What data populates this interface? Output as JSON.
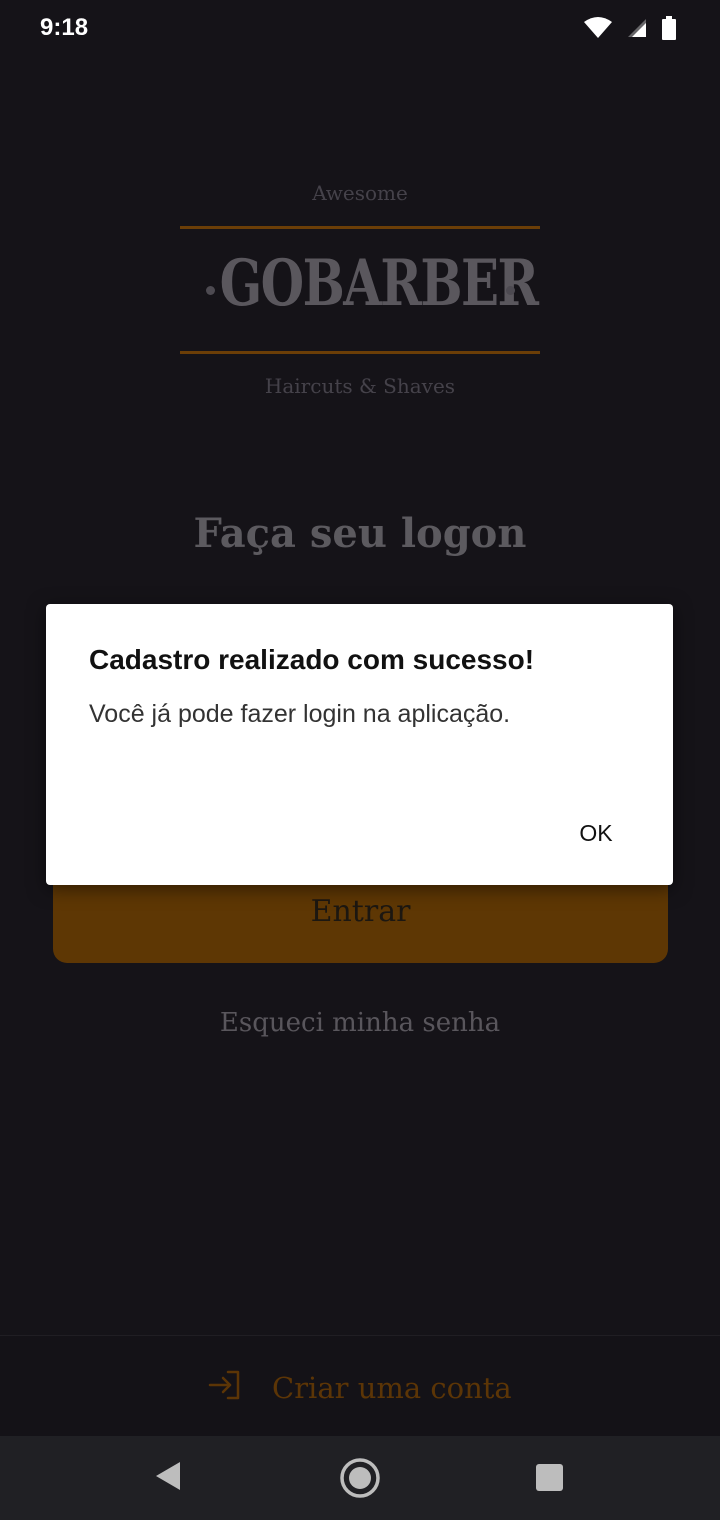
{
  "status_bar": {
    "time": "9:18",
    "icons": [
      "wifi-icon",
      "signal-icon",
      "battery-icon"
    ]
  },
  "logo": {
    "top_text": "Awesome",
    "name": "GOBARBER",
    "tagline": "Haircuts & Shaves"
  },
  "page": {
    "title": "Faça seu logon",
    "login_button": "Entrar",
    "forgot_password": "Esqueci minha senha",
    "create_account": "Criar uma conta"
  },
  "dialog": {
    "title": "Cadastro realizado com sucesso!",
    "message": "Você já pode fazer login na aplicação.",
    "ok_label": "OK"
  },
  "nav_bar": {
    "buttons": [
      "back-icon",
      "home-icon",
      "recents-icon"
    ]
  },
  "colors": {
    "background": "#151318",
    "accent": "#ff9000",
    "dialog_background": "#ffffff"
  }
}
